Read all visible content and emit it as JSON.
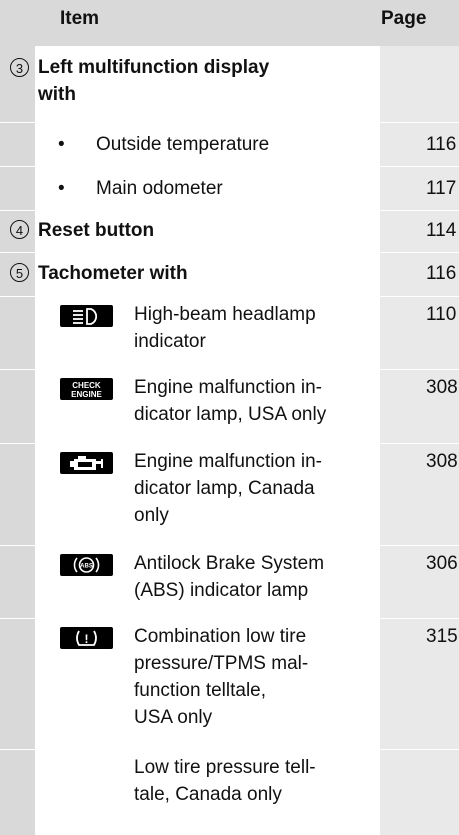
{
  "header": {
    "item": "Item",
    "page": "Page"
  },
  "rows": [
    {
      "num": "3",
      "label_line1": "Left multifunction display",
      "label_line2": "with",
      "page": ""
    },
    {
      "bullet": "•",
      "label": "Outside temperature",
      "page": "116"
    },
    {
      "bullet": "•",
      "label": "Main odometer",
      "page": "117"
    },
    {
      "num": "4",
      "label": "Reset button",
      "page": "114"
    },
    {
      "num": "5",
      "label": "Tachometer with",
      "page": "116"
    },
    {
      "icon": "high-beam-icon",
      "l1": "High-beam headlamp",
      "l2": "indicator",
      "page": "110"
    },
    {
      "icon": "check-engine-icon",
      "icon_text1": "CHECK",
      "icon_text2": "ENGINE",
      "l1": "Engine malfunction in-",
      "l2": "dicator lamp, USA only",
      "page": "308"
    },
    {
      "icon": "engine-icon",
      "l1": "Engine malfunction in-",
      "l2": "dicator lamp, Canada",
      "l3": "only",
      "page": "308"
    },
    {
      "icon": "abs-icon",
      "icon_text": "ABS",
      "l1": "Antilock Brake System",
      "l2": "(ABS) indicator lamp",
      "page": "306"
    },
    {
      "icon": "tire-pressure-icon",
      "icon_text": "!",
      "l1": "Combination low tire",
      "l2": "pressure/TPMS mal-",
      "l3": "function telltale,",
      "l4": "USA only",
      "page": "315"
    },
    {
      "l1": "Low tire pressure tell-",
      "l2": "tale, Canada only"
    }
  ]
}
